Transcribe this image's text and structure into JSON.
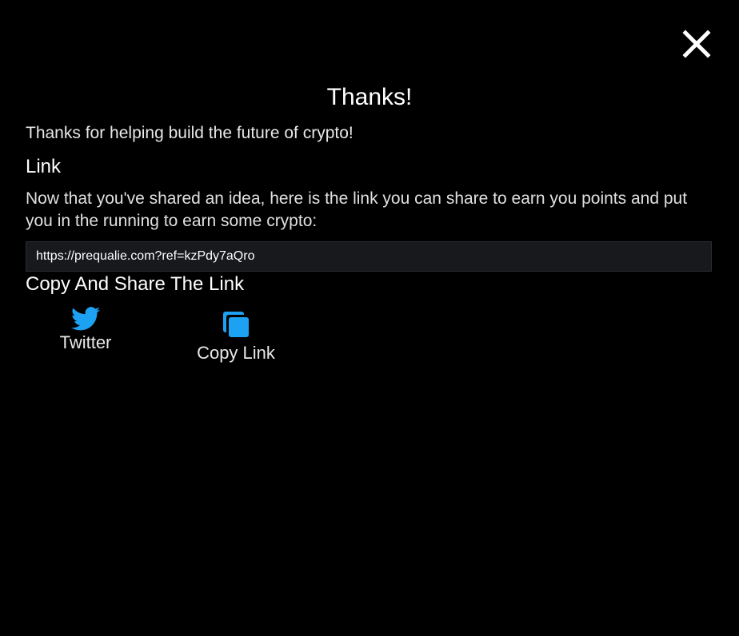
{
  "modal": {
    "title": "Thanks!",
    "subtitle": "Thanks for helping build the future of crypto!",
    "link_heading": "Link",
    "description": "Now that you've shared an idea, here is the link you can share to earn you points and put you in the running to earn some crypto:",
    "link_value": "https://prequalie.com?ref=kzPdy7aQro",
    "share_heading": "Copy And Share The Link",
    "close_icon": "close-icon"
  },
  "share": {
    "twitter": {
      "label": "Twitter",
      "icon": "twitter-icon"
    },
    "copy": {
      "label": "Copy Link",
      "icon": "copy-icon"
    }
  },
  "colors": {
    "background": "#000000",
    "text": "#ffffff",
    "input_background": "#17191d",
    "accent": "#1da1f2"
  }
}
